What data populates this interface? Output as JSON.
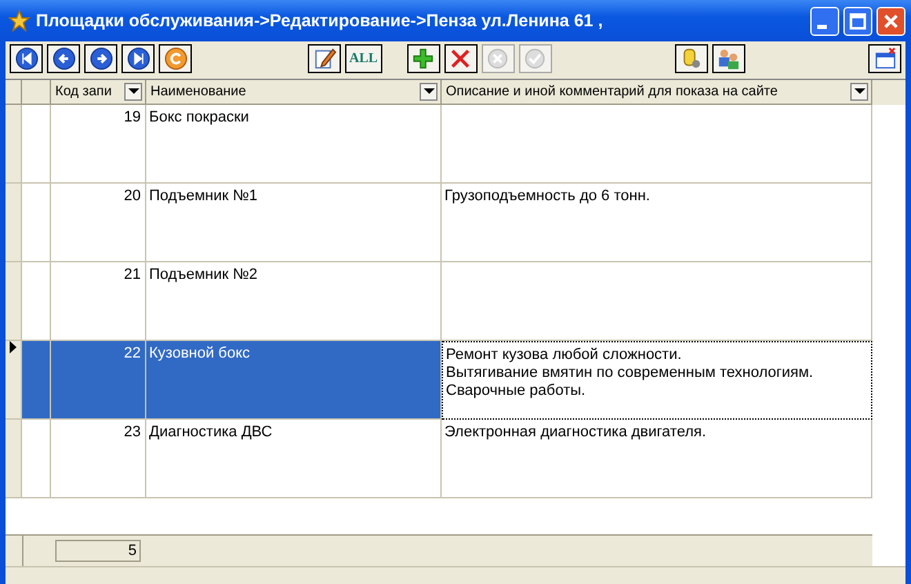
{
  "window": {
    "title": "Площадки обслуживания->Редактирование->Пенза ул.Ленина 61 ,"
  },
  "toolbar": [
    {
      "kind": "first",
      "disabled": false
    },
    {
      "kind": "prev",
      "disabled": false
    },
    {
      "kind": "next",
      "disabled": false
    },
    {
      "kind": "last",
      "disabled": false
    },
    {
      "kind": "refresh",
      "disabled": false
    },
    {
      "kind": "gap"
    },
    {
      "kind": "edit",
      "disabled": false
    },
    {
      "kind": "all",
      "label": "ALL",
      "disabled": false
    },
    {
      "kind": "gap"
    },
    {
      "kind": "add",
      "disabled": false
    },
    {
      "kind": "delete",
      "disabled": false
    },
    {
      "kind": "cancel",
      "disabled": true
    },
    {
      "kind": "confirm",
      "disabled": true
    },
    {
      "kind": "gap"
    },
    {
      "kind": "tools",
      "disabled": false
    },
    {
      "kind": "users",
      "disabled": false
    },
    {
      "kind": "gap"
    },
    {
      "kind": "close-form",
      "disabled": false
    }
  ],
  "table": {
    "columns": [
      "Код запи",
      "Наименование",
      "Описание и иной комментарий для показа на сайте"
    ],
    "rows": [
      {
        "code": "19",
        "name": "Бокс покраски",
        "description": [],
        "selected": false
      },
      {
        "code": "20",
        "name": "Подъемник №1",
        "description": [
          "Грузоподъемность до 6 тонн."
        ],
        "selected": false
      },
      {
        "code": "21",
        "name": "Подъемник №2",
        "description": [],
        "selected": false
      },
      {
        "code": "22",
        "name": "Кузовной бокс",
        "description": [
          "Ремонт кузова любой сложности.",
          "Вытягивание вмятин по современным технологиям.",
          "Сварочные работы."
        ],
        "selected": true
      },
      {
        "code": "23",
        "name": "Диагностика ДВС",
        "description": [
          "Электронная диагностика двигателя."
        ],
        "selected": false
      }
    ]
  },
  "footer": {
    "count": "5"
  }
}
